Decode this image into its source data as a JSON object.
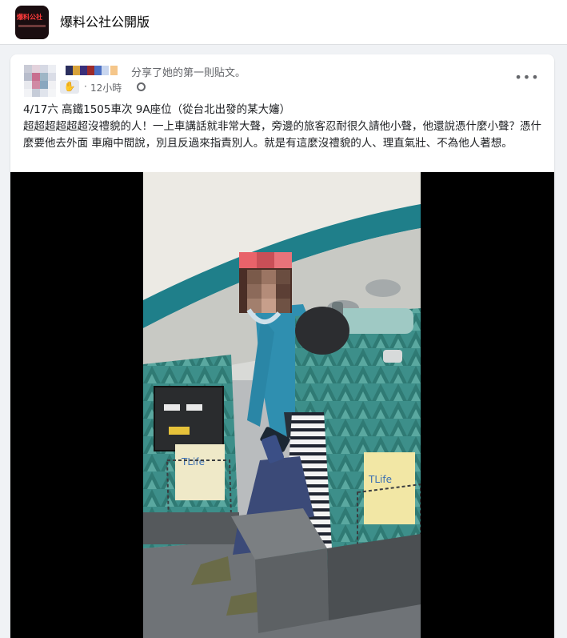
{
  "page": {
    "name": "爆料公社公開版",
    "logo_text": "爆料公社"
  },
  "post": {
    "shared_text": "分享了她的第一則貼文。",
    "time": "12小時",
    "more_label": "•••",
    "privacy_icon": "globe-icon",
    "lines": [
      "4/17六 高鐵1505車次 9A座位（從台北出發的某大嬸）",
      "超超超超超超沒禮貌的人！一上車講話就非常大聲，旁邊的旅客忍耐很久請他小聲，他還說憑什麼小聲？憑什麼要他去外面 車廂中間說，別且反過來指責別人。就是有這麼沒禮貌的人、理直氣壯、不為他人著想。"
    ]
  },
  "video": {
    "seat_card_brand": "TLife"
  },
  "colors": {
    "fb_background": "#f0f2f5",
    "card": "#ffffff",
    "meta_gray": "#65676b",
    "seat_teal": "#3d8f8a",
    "jacket_blue": "#2f8fb0",
    "cap_pink": "#e8636a"
  }
}
